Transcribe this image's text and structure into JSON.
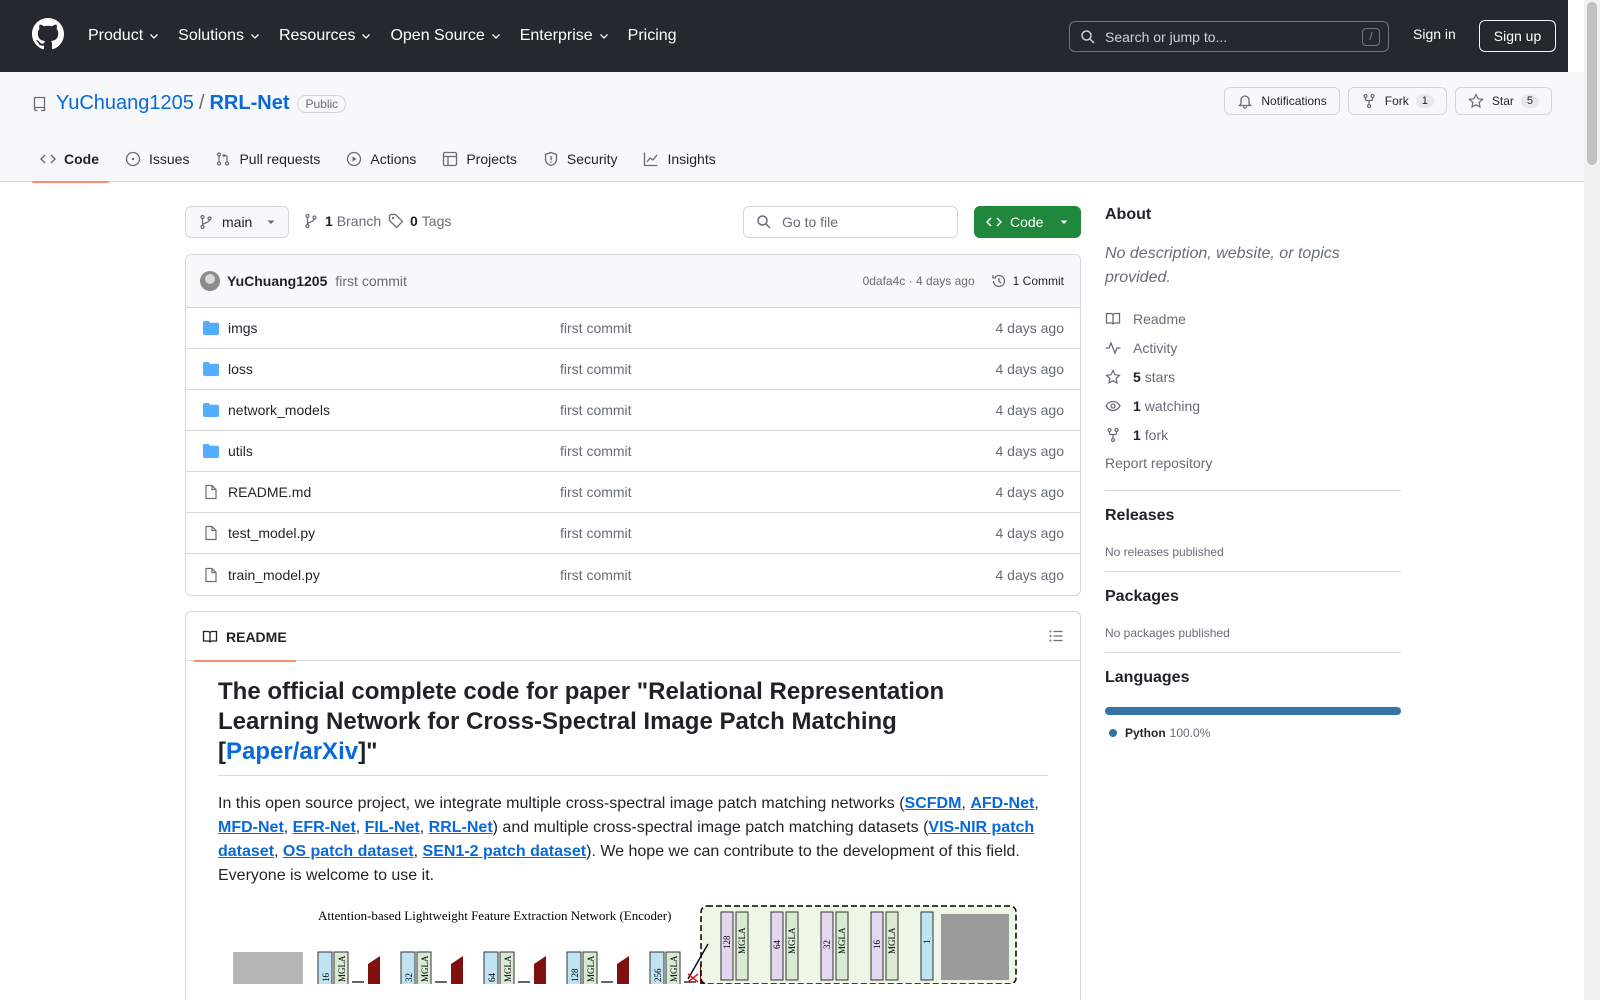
{
  "header": {
    "nav": [
      "Product",
      "Solutions",
      "Resources",
      "Open Source",
      "Enterprise",
      "Pricing"
    ],
    "search_placeholder": "Search or jump to...",
    "search_key": "/",
    "sign_in": "Sign in",
    "sign_up": "Sign up"
  },
  "repo": {
    "owner": "YuChuang1205",
    "separator": "/",
    "name": "RRL-Net",
    "visibility": "Public",
    "notifications_label": "Notifications",
    "fork_label": "Fork",
    "fork_count": "1",
    "star_label": "Star",
    "star_count": "5",
    "tabs": [
      "Code",
      "Issues",
      "Pull requests",
      "Actions",
      "Projects",
      "Security",
      "Insights"
    ]
  },
  "toolbar": {
    "branch": "main",
    "branches_count": "1",
    "branches_label": "Branch",
    "tags_count": "0",
    "tags_label": "Tags",
    "goto_placeholder": "Go to file",
    "code_button": "Code"
  },
  "commit": {
    "author": "YuChuang1205",
    "message": "first commit",
    "meta": "0dafa4c · 4 days ago",
    "count_label": "1 Commit"
  },
  "files": [
    {
      "name": "imgs",
      "type": "folder",
      "message": "first commit",
      "age": "4 days ago"
    },
    {
      "name": "loss",
      "type": "folder",
      "message": "first commit",
      "age": "4 days ago"
    },
    {
      "name": "network_models",
      "type": "folder",
      "message": "first commit",
      "age": "4 days ago"
    },
    {
      "name": "utils",
      "type": "folder",
      "message": "first commit",
      "age": "4 days ago"
    },
    {
      "name": "README.md",
      "type": "file",
      "message": "first commit",
      "age": "4 days ago"
    },
    {
      "name": "test_model.py",
      "type": "file",
      "message": "first commit",
      "age": "4 days ago"
    },
    {
      "name": "train_model.py",
      "type": "file",
      "message": "first commit",
      "age": "4 days ago"
    }
  ],
  "readme": {
    "tab_label": "README",
    "title_pre": "The official complete code for paper \"Relational Representation Learning Network for Cross-Spectral Image Patch Matching [",
    "title_link": "Paper/arXiv",
    "title_post": "]\"",
    "p_intro": "In this open source project, we integrate multiple cross-spectral image patch matching networks (",
    "net_links": [
      "SCFDM",
      "AFD-Net",
      "MFD-Net",
      "EFR-Net",
      "FIL-Net",
      "RRL-Net"
    ],
    "p_mid": ") and multiple cross-spectral image patch matching datasets (",
    "dataset_links": [
      "VIS-NIR patch dataset",
      "OS patch dataset",
      "SEN1-2 patch dataset"
    ],
    "p_end": "). We hope we can contribute to the development of this field. Everyone is welcome to use it.",
    "figure_caption": "Attention-based Lightweight Feature Extraction Network (Encoder)",
    "figure_labels": [
      "16",
      "MGLA",
      "32",
      "MGLA",
      "64",
      "MGLA",
      "128",
      "MGLA",
      "256",
      "MGLA",
      "128",
      "MGLA",
      "64",
      "MGLA",
      "32",
      "MGLA",
      "16",
      "MGLA",
      "1"
    ]
  },
  "sidebar": {
    "about_title": "About",
    "about_desc": "No description, website, or topics provided.",
    "readme": "Readme",
    "activity": "Activity",
    "stars_count": "5",
    "stars_label": "stars",
    "watching_count": "1",
    "watching_label": "watching",
    "fork_count": "1",
    "fork_label": "fork",
    "report": "Report repository",
    "releases_title": "Releases",
    "releases_empty": "No releases published",
    "packages_title": "Packages",
    "packages_empty": "No packages published",
    "languages_title": "Languages",
    "language_name": "Python",
    "language_pct": "100.0%",
    "language_fraction": 1.0,
    "language_color": "#3572a5"
  },
  "colors": {
    "header_bg": "#24292f",
    "link": "#0969da",
    "primary_button": "#1f883d",
    "selected_tab_underline": "#fd8c73"
  }
}
